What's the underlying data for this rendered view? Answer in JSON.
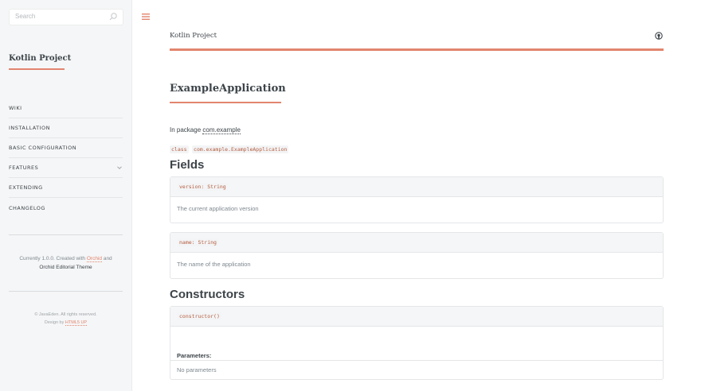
{
  "search": {
    "placeholder": "Search"
  },
  "sidebar": {
    "brand": "Kotlin Project",
    "items": [
      {
        "label": "WIKI",
        "has_children": false
      },
      {
        "label": "INSTALLATION",
        "has_children": false
      },
      {
        "label": "BASIC CONFIGURATION",
        "has_children": false
      },
      {
        "label": "FEATURES",
        "has_children": true
      },
      {
        "label": "EXTENDING",
        "has_children": false
      },
      {
        "label": "CHANGELOG",
        "has_children": false
      }
    ],
    "credits": {
      "prefix": "Currently 1.0.0. Created with",
      "link": "Orchid",
      "suffix": "and",
      "theme": "Orchid Editorial Theme"
    },
    "footer": {
      "copyright": "© JavaEden. All rights reserved.",
      "design_prefix": "Design by",
      "design_link": "HTML5 UP"
    }
  },
  "header": {
    "title": "Kotlin Project",
    "github_icon": "github-icon"
  },
  "page": {
    "title": "ExampleApplication",
    "package_prefix": "In package",
    "package_name": "com.example",
    "class_keyword": "class",
    "class_name": "com.example.ExampleApplication",
    "fields_heading": "Fields",
    "fields": [
      {
        "signature": "version: String",
        "description": "The current application version"
      },
      {
        "signature": "name: String",
        "description": "The name of the application"
      }
    ],
    "constructors_heading": "Constructors",
    "constructor": {
      "signature": "constructor()",
      "params_label": "Parameters:",
      "params_value": "No parameters"
    }
  },
  "colors": {
    "accent": "#e2856e",
    "text_dark": "#3d4449",
    "text": "#7f888f",
    "sidebar_bg": "#f5f6f7"
  }
}
